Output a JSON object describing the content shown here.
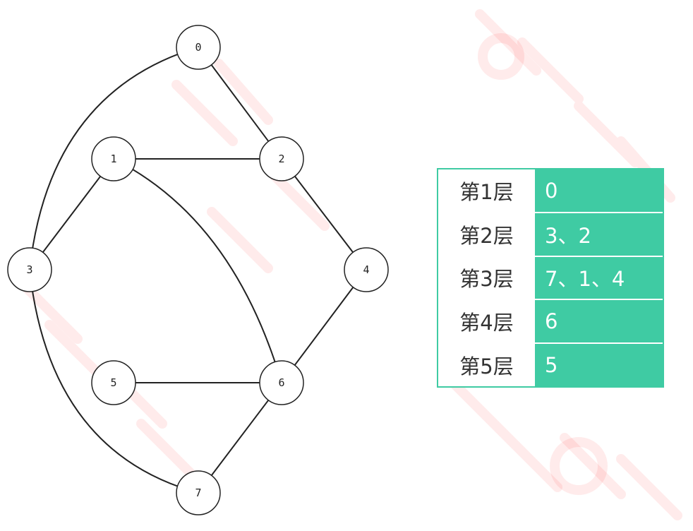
{
  "graph": {
    "nodes": [
      {
        "id": "0",
        "label": "0"
      },
      {
        "id": "1",
        "label": "1"
      },
      {
        "id": "2",
        "label": "2"
      },
      {
        "id": "3",
        "label": "3"
      },
      {
        "id": "4",
        "label": "4"
      },
      {
        "id": "5",
        "label": "5"
      },
      {
        "id": "6",
        "label": "6"
      },
      {
        "id": "7",
        "label": "7"
      }
    ],
    "edges": [
      [
        "0",
        "2"
      ],
      [
        "0",
        "3"
      ],
      [
        "1",
        "2"
      ],
      [
        "1",
        "3"
      ],
      [
        "1",
        "6"
      ],
      [
        "2",
        "4"
      ],
      [
        "4",
        "6"
      ],
      [
        "5",
        "6"
      ],
      [
        "6",
        "7"
      ],
      [
        "3",
        "7"
      ]
    ]
  },
  "levels": [
    {
      "label": "第1层",
      "nodes": "0"
    },
    {
      "label": "第2层",
      "nodes": "3、2"
    },
    {
      "label": "第3层",
      "nodes": "7、1、4"
    },
    {
      "label": "第4层",
      "nodes": "6"
    },
    {
      "label": "第5层",
      "nodes": "5"
    }
  ],
  "colors": {
    "accent": "#3fcba3",
    "line": "#222222",
    "watermark": "#ff0000"
  }
}
